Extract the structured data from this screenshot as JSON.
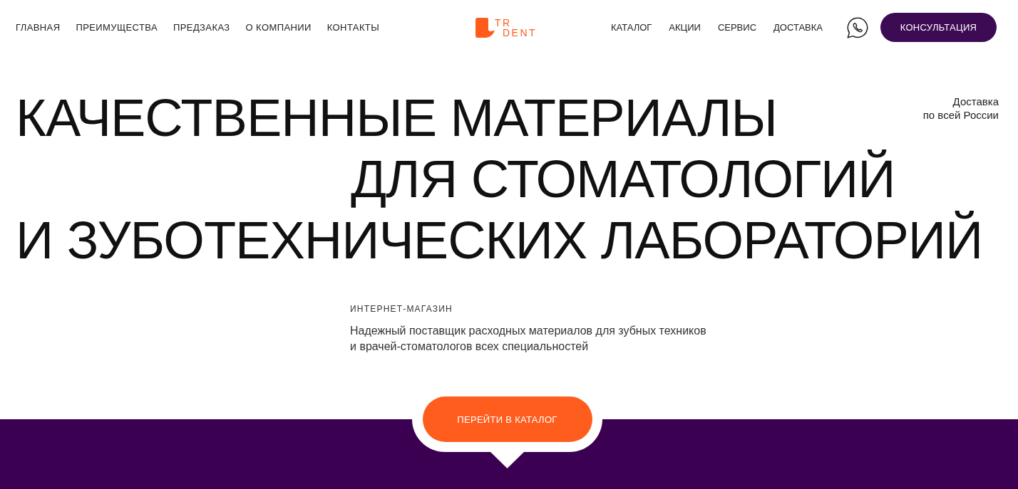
{
  "header": {
    "nav_left": [
      {
        "label": "ГЛАВНАЯ"
      },
      {
        "label": "ПРЕИМУЩЕСТВА"
      },
      {
        "label": "ПРЕДЗАКАЗ"
      },
      {
        "label": "О КОМПАНИИ"
      },
      {
        "label": "КОНТАКТЫ"
      }
    ],
    "logo": {
      "lines": [
        "TR",
        "DENT"
      ]
    },
    "nav_right": [
      {
        "label": "КАТАЛОГ"
      },
      {
        "label": "АКЦИИ"
      },
      {
        "label": "СЕРВИС"
      },
      {
        "label": "ДОСТАВКА"
      }
    ],
    "consult_button": {
      "label": "КОНСУЛЬТАЦИЯ"
    }
  },
  "hero": {
    "title_lines": [
      "КАЧЕСТВЕННЫЕ МАТЕРИАЛЫ",
      "ДЛЯ СТОМАТОЛОГИЙ",
      "И ЗУБОТЕХНИЧЕСКИХ ЛАБОРАТОРИЙ"
    ],
    "delivery_note_lines": [
      "Доставка",
      "по всей России"
    ],
    "eyebrow": "ИНТЕРНЕТ-МАГАЗИН",
    "description": "Надежный поставщик расходных материалов для зубных техников и врачей-стоматологов всех специальностей"
  },
  "cta_button": {
    "label": "ПЕРЕЙТИ В КАТАЛОГ"
  }
}
